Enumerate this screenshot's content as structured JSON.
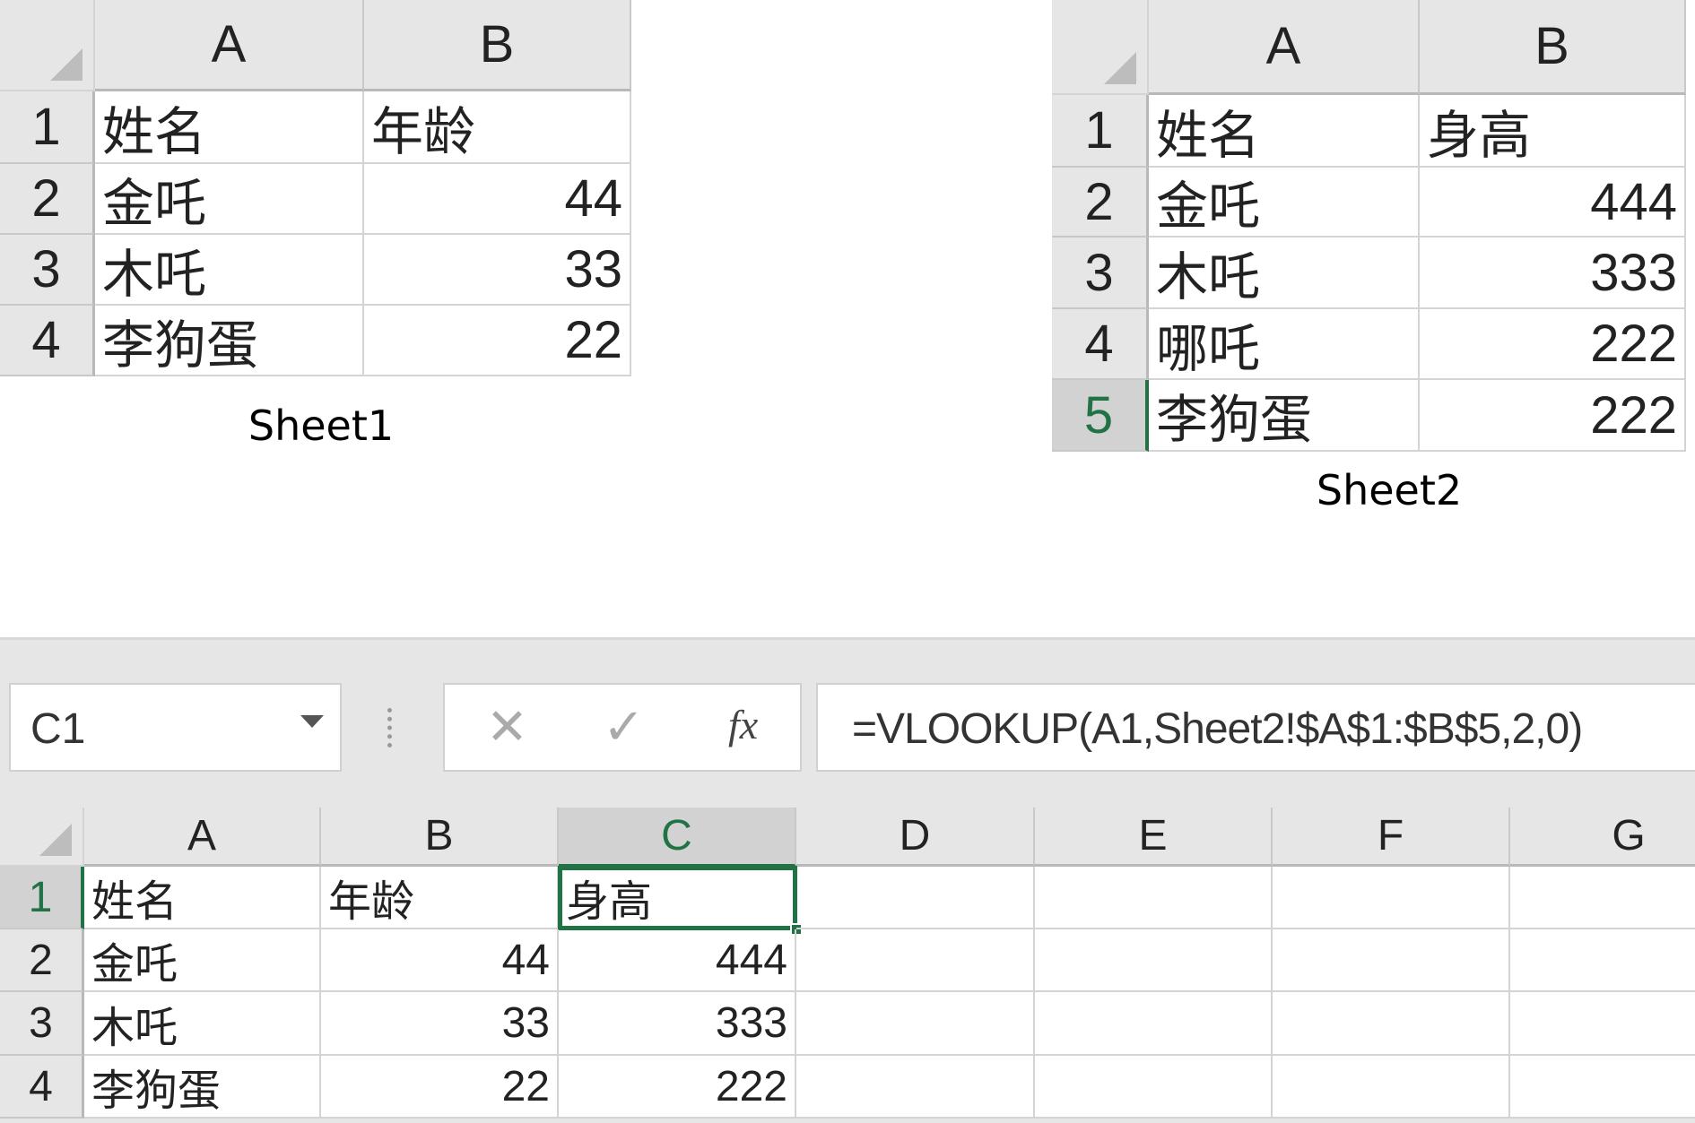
{
  "sheet1": {
    "caption": "Sheet1",
    "columns": [
      "A",
      "B"
    ],
    "rows": [
      [
        "1",
        "姓名",
        "年龄"
      ],
      [
        "2",
        "金吒",
        "44"
      ],
      [
        "3",
        "木吒",
        "33"
      ],
      [
        "4",
        "李狗蛋",
        "22"
      ]
    ]
  },
  "sheet2": {
    "caption": "Sheet2",
    "columns": [
      "A",
      "B"
    ],
    "rows": [
      [
        "1",
        "姓名",
        "身高"
      ],
      [
        "2",
        "金吒",
        "444"
      ],
      [
        "3",
        "木吒",
        "333"
      ],
      [
        "4",
        "哪吒",
        "222"
      ],
      [
        "5",
        "李狗蛋",
        "222"
      ]
    ]
  },
  "workbook": {
    "name_box": "C1",
    "formula": "=VLOOKUP(A1,Sheet2!$A$1:$B$5,2,0)",
    "fx_label": "fx",
    "columns": [
      "A",
      "B",
      "C",
      "D",
      "E",
      "F",
      "G"
    ],
    "rows": [
      [
        "1",
        "姓名",
        "年龄",
        "身高"
      ],
      [
        "2",
        "金吒",
        "44",
        "444"
      ],
      [
        "3",
        "木吒",
        "33",
        "333"
      ],
      [
        "4",
        "李狗蛋",
        "22",
        "222"
      ]
    ],
    "selected_cell": "C1",
    "accent": "#217346"
  }
}
